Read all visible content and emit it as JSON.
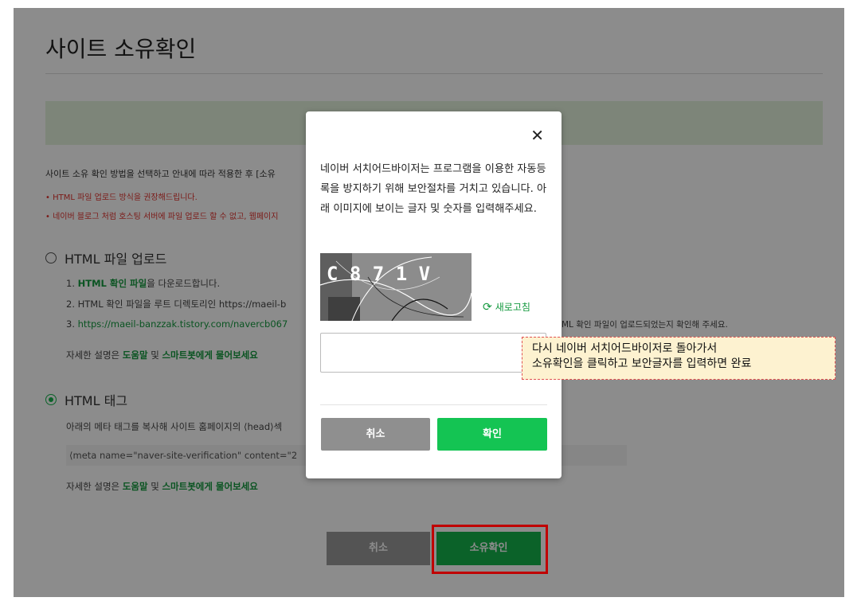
{
  "page": {
    "title": "사이트 소유확인",
    "intro": "사이트 소유 확인 방법을 선택하고 안내에 따라 적용한 후 [소유",
    "notes": [
      "• HTML 파일 업로드 방식을 권장해드립니다.",
      "• 네이버 블로그 처럼 호스팅 서버에 파일 업로드 할 수 없고, 웹페이지"
    ],
    "method_html_file": {
      "label": "HTML 파일 업로드",
      "step1_prefix": "1. ",
      "step1_link": "HTML 확인 파일",
      "step1_suffix": "을 다운로드합니다.",
      "step2": "2. HTML 확인 파일을 루트 디렉토리인 https://maeil-b",
      "step3_prefix": "3. ",
      "step3_link": "https://maeil-banzzak.tistory.com/navercb067",
      "step3_right": "ML 확인 파일이 업로드되었는지 확인해 주세요.",
      "help_prefix": "자세한 설명은 ",
      "help_link1": "도움말",
      "help_mid": " 및 ",
      "help_link2": "스마트봇에게 물어보세요"
    },
    "method_html_tag": {
      "label": "HTML 태그",
      "desc": "아래의 메타 태그를 복사해 사이트 홈페이지의 ⟨head⟩섹",
      "meta": "⟨meta name=\"naver-site-verification\" content=\"2",
      "help_prefix": "자세한 설명은 ",
      "help_link1": "도움말",
      "help_mid": " 및 ",
      "help_link2": "스마트봇에게 물어보세요"
    },
    "buttons": {
      "cancel": "취소",
      "confirm": "소유확인"
    }
  },
  "modal": {
    "close_icon": "close-icon",
    "message": "네이버 서치어드바이저는 프로그램을 이용한 자동등록을 방지하기 위해 보안절차를 거치고 있습니다. 아래 이미지에 보이는 글자 및 숫자를 입력해주세요.",
    "captcha_text": "C 8 7 1 V",
    "refresh_label": "새로고침",
    "input_value": "",
    "cancel": "취소",
    "confirm": "확인"
  },
  "annotation": {
    "line1": "다시 네이버 서치어드바이저로 돌아가서",
    "line2": "소유확인을 클릭하고 보안글자를 입력하면 완료"
  },
  "colors": {
    "accent_green": "#14b24b",
    "highlight_red": "#c00000",
    "annotation_bg": "#fdf2d0"
  }
}
